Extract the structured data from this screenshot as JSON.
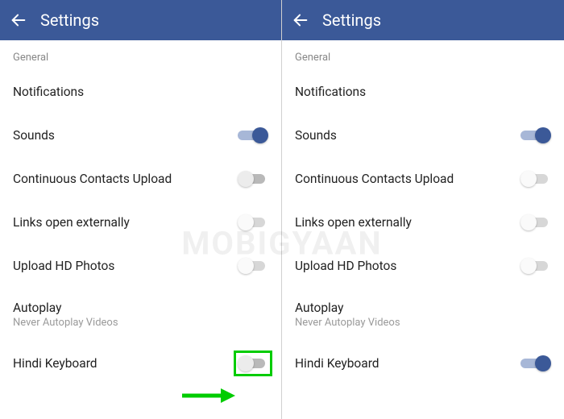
{
  "appbar": {
    "title": "Settings"
  },
  "section": {
    "general": "General"
  },
  "rows": {
    "notifications": "Notifications",
    "sounds": "Sounds",
    "contactsUpload": "Continuous Contacts Upload",
    "linksExt": "Links open externally",
    "uploadHd": "Upload HD Photos",
    "autoplay": "Autoplay",
    "autoplaySub": "Never Autoplay Videos",
    "hindiKeyboard": "Hindi Keyboard"
  },
  "toggles": {
    "left": {
      "sounds": "on",
      "contactsUpload": "off",
      "linksExt": "off-white",
      "uploadHd": "off-white",
      "hindiKeyboard": "off"
    },
    "right": {
      "sounds": "on",
      "contactsUpload": "off-white",
      "linksExt": "off-white",
      "uploadHd": "off-white",
      "hindiKeyboard": "on"
    }
  },
  "watermark": "MOBIGYAAN"
}
